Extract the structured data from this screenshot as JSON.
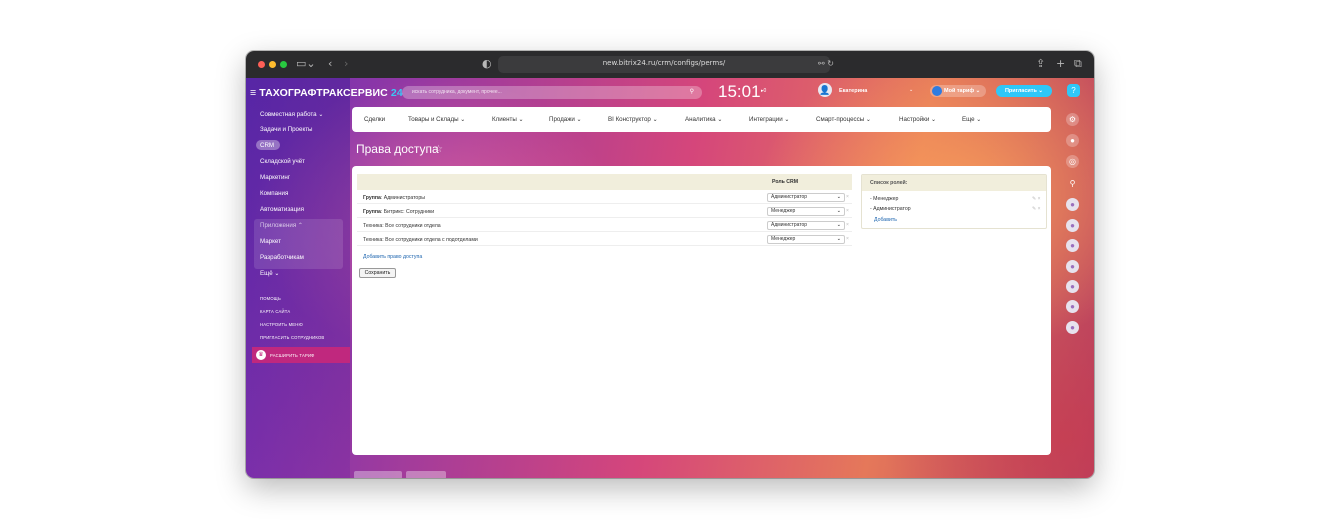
{
  "browser": {
    "url": "new.bitrix24.ru/crm/configs/perms/",
    "traffic_lights": [
      "#ff5f57",
      "#febc2e",
      "#28c840"
    ]
  },
  "header": {
    "brand": "ТАХОГРАФТРАКСЕРВИС",
    "brand_suffix": "24",
    "search_placeholder": "искать сотрудника, документ, прочее...",
    "clock": "15:01",
    "user_name": "Екатерина",
    "plan_label": "Мой тариф",
    "invite_label": "Пригласить"
  },
  "sidebar": {
    "items": [
      {
        "label": "Совместная работа ⌄"
      },
      {
        "label": "Задачи и Проекты"
      },
      {
        "label": "CRM"
      },
      {
        "label": "Складской учёт"
      },
      {
        "label": "Маркетинг"
      },
      {
        "label": "Компания"
      },
      {
        "label": "Автоматизация"
      },
      {
        "label": "Приложения ⌃"
      },
      {
        "label": "Маркет"
      },
      {
        "label": "Разработчикам"
      },
      {
        "label": "Ещё ⌄"
      }
    ],
    "links": [
      {
        "label": "помощь"
      },
      {
        "label": "карта сайта"
      },
      {
        "label": "настроить меню"
      },
      {
        "label": "пригласить сотрудников"
      }
    ],
    "upgrade_label": "расширить тариф"
  },
  "nav": {
    "items": [
      {
        "label": "Сделки"
      },
      {
        "label": "Товары и Склады ⌄"
      },
      {
        "label": "Клиенты ⌄"
      },
      {
        "label": "Продажи ⌄"
      },
      {
        "label": "BI Конструктор ⌄"
      },
      {
        "label": "Аналитика ⌄"
      },
      {
        "label": "Интеграции ⌄"
      },
      {
        "label": "Смарт-процессы ⌄"
      },
      {
        "label": "Настройки ⌄"
      },
      {
        "label": "Еще ⌄"
      }
    ]
  },
  "page": {
    "title": "Права доступа",
    "table_header_role": "Роль CRM",
    "rows": [
      {
        "label_bold": "Группа",
        "label": ": Администраторы",
        "role": "Администратор"
      },
      {
        "label_bold": "Группа",
        "label": ": Битрикс: Сотрудники",
        "role": "Менеджер"
      },
      {
        "label_bold": "",
        "label": "Техника: Все сотрудники отдела",
        "role": "Администратор"
      },
      {
        "label_bold": "",
        "label": "Техника: Все сотрудники отдела с подотделами",
        "role": "Менеджер"
      }
    ],
    "add_access_link": "Добавить право доступа",
    "save_label": "Сохранить"
  },
  "roles": {
    "title": "Список ролей:",
    "items": [
      {
        "label": "- Менеджер"
      },
      {
        "label": "- Администратор"
      }
    ],
    "add_label": "Добавить"
  },
  "colors": {
    "accent_blue": "#2fc7f7",
    "link_blue": "#2067b0",
    "upgrade_pink": "#c0287e"
  }
}
